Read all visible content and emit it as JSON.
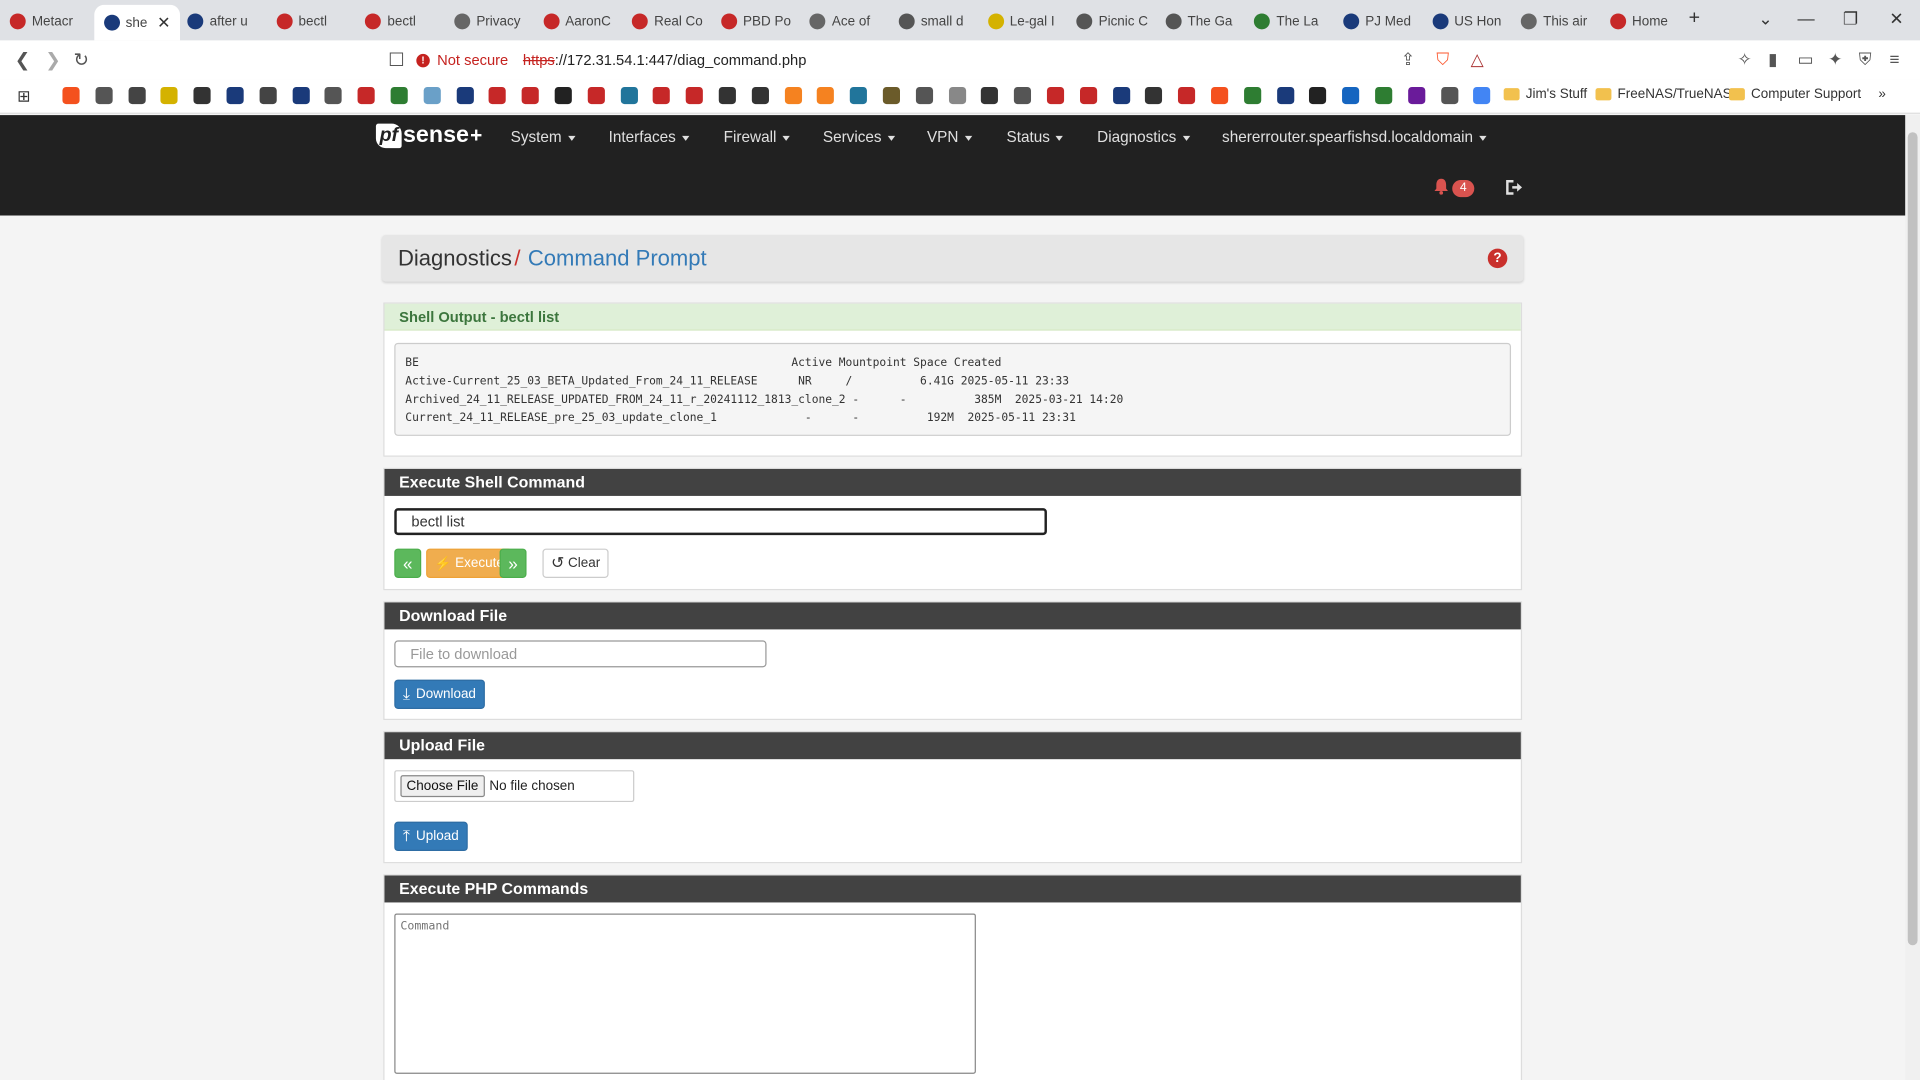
{
  "browser": {
    "tabs": [
      {
        "label": "Metacr",
        "color": "#c62828"
      },
      {
        "label": "she",
        "color": "#1a3a7a",
        "active": true
      },
      {
        "label": "after u",
        "color": "#1a3a7a"
      },
      {
        "label": "bectl",
        "color": "#c62828"
      },
      {
        "label": "bectl",
        "color": "#c62828"
      },
      {
        "label": "Privacy",
        "color": "#666"
      },
      {
        "label": "AaronC",
        "color": "#c62828"
      },
      {
        "label": "Real Co",
        "color": "#c62828"
      },
      {
        "label": "PBD Po",
        "color": "#c62828"
      },
      {
        "label": "Ace of",
        "color": "#666"
      },
      {
        "label": "small d",
        "color": "#555"
      },
      {
        "label": "Le-gal I",
        "color": "#d4b200"
      },
      {
        "label": "Picnic C",
        "color": "#555"
      },
      {
        "label": "The Ga",
        "color": "#555"
      },
      {
        "label": "The La",
        "color": "#2e7d32"
      },
      {
        "label": "PJ Med",
        "color": "#1a3a7a"
      },
      {
        "label": "US Hon",
        "color": "#1a3a7a"
      },
      {
        "label": "This air",
        "color": "#666"
      },
      {
        "label": "Home",
        "color": "#c62828"
      }
    ],
    "new_tab": "+",
    "not_secure": "Not secure",
    "url_scheme": "https",
    "url_rest": "://172.31.54.1:447/diag_command.php",
    "bookmark_folders": [
      "Jim's Stuff",
      "FreeNAS/TrueNAS",
      "Computer Support"
    ]
  },
  "nav": {
    "logo_pf": "pf",
    "logo_sense": "sense",
    "logo_plus": "+",
    "menus": [
      "System",
      "Interfaces",
      "Firewall",
      "Services",
      "VPN",
      "Status",
      "Diagnostics",
      "shererrouter.spearfishsd.localdomain"
    ],
    "notifications": "4"
  },
  "breadcrumb": {
    "parent": "Diagnostics",
    "separator": "/",
    "current": "Command Prompt"
  },
  "shell_output": {
    "title": "Shell Output - bectl list",
    "header": "BE                                                       Active Mountpoint Space Created",
    "rows": [
      "Active-Current_25_03_BETA_Updated_From_24_11_RELEASE      NR     /          6.41G 2025-05-11 23:33",
      "Archived_24_11_RELEASE_UPDATED_FROM_24_11_r_20241112_1813_clone_2 -      -          385M  2025-03-21 14:20",
      "Current_24_11_RELEASE_pre_25_03_update_clone_1             -      -          192M  2025-05-11 23:31"
    ]
  },
  "execute_shell": {
    "title": "Execute Shell Command",
    "value": "bectl list",
    "prev_label": "«",
    "execute_label": "Execute",
    "next_label": "»",
    "clear_label": "Clear"
  },
  "download": {
    "title": "Download File",
    "placeholder": "File to download",
    "button": "Download"
  },
  "upload": {
    "title": "Upload File",
    "choose": "Choose File",
    "no_file": "No file chosen",
    "button": "Upload"
  },
  "php": {
    "title": "Execute PHP Commands",
    "placeholder": "Command"
  }
}
